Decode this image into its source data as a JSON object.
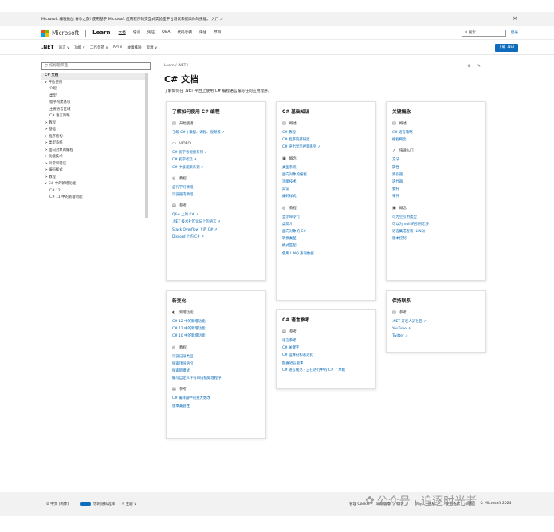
{
  "banner": {
    "text": "Microsoft 编程挑战 春季之旅! 使用基于 Microsoft 应用程序的交互式实验室平台测试和提高你的技能。 入门 >",
    "close": "×"
  },
  "header": {
    "brand": "Microsoft",
    "product": "Learn",
    "nav": [
      "文档",
      "培训",
      "凭证",
      "Q&A",
      "代码示例",
      "评估",
      "节目"
    ],
    "search_placeholder": "搜索",
    "signin": "登录"
  },
  "subheader": {
    "title": ".NET",
    "nav": [
      "语言 ∨",
      "功能 ∨",
      "工作负荷 ∨",
      "API ∨",
      "故障排除",
      "资源 ∨"
    ],
    "download": "下载 .NET"
  },
  "sidebar": {
    "filter_placeholder": "按标题筛选",
    "items": [
      "C# 文档",
      "∨ 开始使用",
      "介绍",
      "类型",
      "程序构建基块",
      "主要语言区域",
      "C# 语言策略",
      "> 教程",
      "> 基础",
      "> 程序结构",
      "> 类型系统",
      "> 面向对象的编程",
      "> 功能技术",
      "> 异常和错误",
      "> 编码样式",
      "> 教程",
      "∨ C# 中的新增功能",
      "C# 12",
      "C# 11 中的新增功能"
    ]
  },
  "main": {
    "breadcrumb": "Learn / .NET /",
    "title": "C# 文档",
    "description": "了解如何在 .NET 平台上使用 C# 编程语言编写任何应用程序。"
  },
  "cards": {
    "learn": {
      "title": "了解如何使用 C# 编程",
      "sections": [
        {
          "icon": "▤",
          "head": "开始使用",
          "links": [
            "了解 C# | 教程、课程、视频等 ↗"
          ]
        },
        {
          "icon": "▭",
          "head": "VIDEO",
          "links": [
            "C# 初学者视频系列 ↗",
            "C# 初学者流 ↗",
            "C# 中级视频系列 ↗"
          ]
        },
        {
          "icon": "◎",
          "head": "教程",
          "links": [
            "自行学习教程",
            "浏览器内教程"
          ]
        },
        {
          "icon": "▤",
          "head": "参考",
          "links": [
            "Q&A 上的 C# ↗",
            ".NET 技术社区论坛上的语言 ↗",
            "Stack Overflow 上的 C# ↗",
            "Discord 上的 C# ↗"
          ]
        }
      ]
    },
    "basics": {
      "title": "C# 基础知识",
      "sections": [
        {
          "icon": "▤",
          "head": "概述",
          "links": [
            "C# 教程",
            "C# 程序内部研究",
            "C# 突出显示视频系列 ↗"
          ]
        },
        {
          "icon": "▣",
          "head": "概念",
          "links": [
            "类型系统",
            "面向对象的编程",
            "功能技术",
            "异常",
            "编码样式"
          ]
        },
        {
          "icon": "◎",
          "head": "教程",
          "links": [
            "显示命令行",
            "类简介",
            "面向对象的 C#",
            "转换类型",
            "模式匹配",
            "使用 LINQ 查询数据"
          ]
        }
      ]
    },
    "concepts": {
      "title": "关键概念",
      "sections": [
        {
          "icon": "▤",
          "head": "概述",
          "links": [
            "C# 语言策略",
            "编程概念"
          ]
        },
        {
          "icon": "↗",
          "head": "快速入门",
          "links": [
            "方法",
            "属性",
            "索引器",
            "迭代器",
            "委托",
            "事件"
          ]
        },
        {
          "icon": "▣",
          "head": "概念",
          "links": [
            "可为空引用类型",
            "可以为 null 的引用迁移",
            "语言集成查询 (LINQ)",
            "版本控制"
          ]
        }
      ]
    },
    "whatsnew": {
      "title": "新变化",
      "sections": [
        {
          "icon": "◐",
          "head": "新增功能",
          "links": [
            "C# 12 中的新增功能",
            "C# 11 中的新增功能",
            "C# 10 中的新增功能"
          ]
        },
        {
          "icon": "◎",
          "head": "教程",
          "links": [
            "浏览记录类型",
            "探索顶层语句",
            "探索新模式",
            "编写自定义字符串内插处理程序"
          ]
        },
        {
          "icon": "▤",
          "head": "参考",
          "links": [
            "C# 编译器中的重大更改",
            "版本兼容性"
          ]
        }
      ]
    },
    "reference": {
      "title": "C# 语言参考",
      "sections": [
        {
          "icon": "▤",
          "head": "参考",
          "links": [
            "语言参考",
            "C# 关键字",
            "C# 运算符和表达式",
            "配置语言版本",
            "C# 语言规范 - 正在进行中的 C# 7 草稿"
          ]
        }
      ]
    },
    "contact": {
      "title": "保持联系",
      "sections": [
        {
          "icon": "▤",
          "head": "参考",
          "links": [
            ".NET 开发人员社区 ↗",
            "YouTube ↗",
            "Twitter ↗"
          ]
        }
      ]
    }
  },
  "footer": {
    "language": "⊘ 中文 (简体)",
    "privacy": "你的隐私选择",
    "theme": "☼ 主题 ∨",
    "links": [
      "管理 Cookie",
      "早期版本",
      "博客 ↗",
      "参与",
      "隐私 ↗",
      "使用条款",
      "商标",
      "© Microsoft 2024"
    ]
  },
  "watermark": "公众号 · 追逐时光者",
  "colors": {
    "accent": "#0065b3",
    "button": "#0f6cbd",
    "logo": [
      "#f25022",
      "#7fba00",
      "#00a4ef",
      "#ffb900"
    ]
  }
}
